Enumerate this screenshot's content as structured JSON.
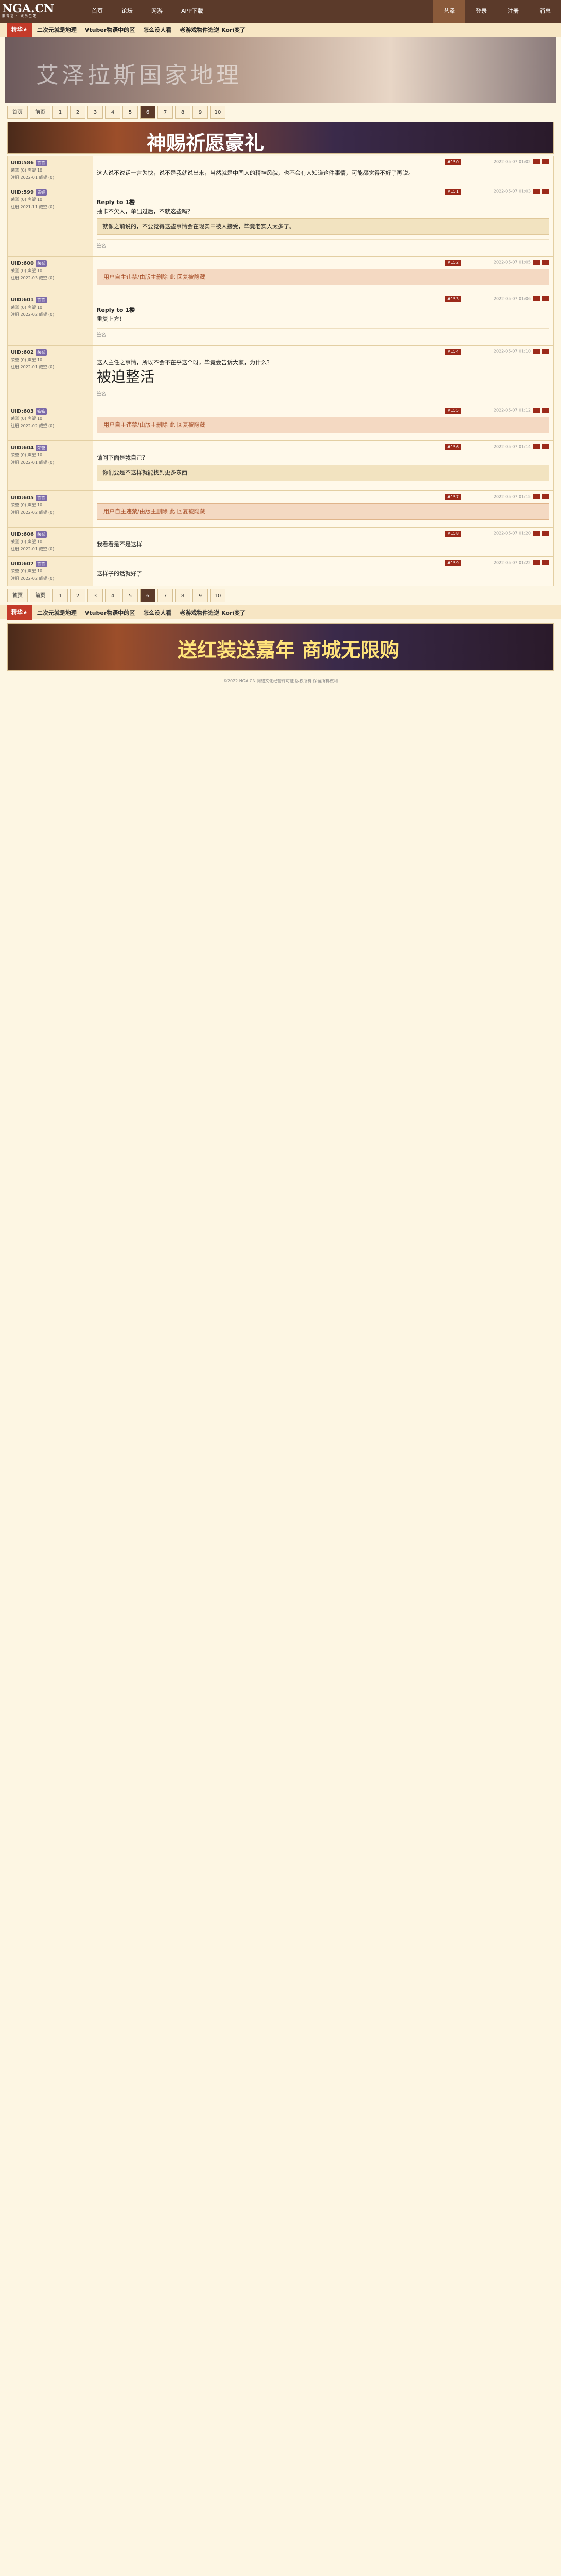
{
  "top": {
    "logo": "NGA.CN",
    "logo_sub": "旧曾谙 · 娱乐至死",
    "nav": [
      "首页",
      "论坛",
      "网游",
      "APP下载"
    ],
    "right": [
      "艺泽",
      "登录",
      "注册",
      "消息"
    ]
  },
  "bar2": {
    "tag": "精华★",
    "links": [
      "二次元就是地理",
      "Vtuber物语中的区",
      "怎么没人看",
      "老游戏物件造逆 Kori变了"
    ]
  },
  "banner": {
    "title": "艾泽拉斯国家地理"
  },
  "pager": {
    "first": "首页",
    "prev": "前页",
    "pages": [
      "1",
      "2",
      "3",
      "4",
      "5",
      "6",
      "7",
      "8",
      "9",
      "10"
    ],
    "current": "6"
  },
  "ad1": {
    "text": "神赐祈愿豪礼"
  },
  "posts": [
    {
      "user": "UID:586",
      "badge": "铁铁",
      "level": "荣誉 (0) 声望 10",
      "stats": "注册 2022-01 威望 (0)",
      "floor": "#150",
      "time": "2022-05-07 01:02",
      "content": "这人说不说话一言为快，说不是我就说出来，当然就是中国人的精神风貌，也不会有人知道这件事情，可能都觉得不好了再说。"
    },
    {
      "user": "UID:599",
      "badge": "青铜",
      "level": "荣誉 (0) 声望 10",
      "stats": "注册 2021-11 威望 (0)",
      "floor": "#151",
      "time": "2022-05-07 01:03",
      "reply": "Reply to 1楼",
      "content": "抽卡不欠人，单出过后，不就这些吗？",
      "extra": "就像之前说的，不要觉得这些事情会在现实中被人接受，毕竟老实人太多了。",
      "sig": "签名"
    },
    {
      "user": "UID:600",
      "badge": "荣誉",
      "level": "荣誉 (0) 声望 10",
      "stats": "注册 2022-03 威望 (0)",
      "floor": "#152",
      "time": "2022-05-07 01:05",
      "hidden": "用户自主违禁/由版主删除 此 回复被隐藏"
    },
    {
      "user": "UID:601",
      "badge": "铁铁",
      "level": "荣誉 (0) 声望 10",
      "stats": "注册 2022-02 威望 (0)",
      "floor": "#153",
      "time": "2022-05-07 01:06",
      "reply": "Reply to 1楼",
      "content": "重复上方！",
      "sig": "签名"
    },
    {
      "user": "UID:602",
      "badge": "荣誉",
      "level": "荣誉 (0) 声望 10",
      "stats": "注册 2022-01 威望 (0)",
      "floor": "#154",
      "time": "2022-05-07 01:10",
      "content": "这人主任之事情，所以不会不在乎这个呀，毕竟会告诉大家，为什么？",
      "big": "被迫整活",
      "sig": "签名"
    },
    {
      "user": "UID:603",
      "badge": "铁铁",
      "level": "荣誉 (0) 声望 10",
      "stats": "注册 2022-02 威望 (0)",
      "floor": "#155",
      "time": "2022-05-07 01:12",
      "hidden": "用户自主违禁/由版主删除 此 回复被隐藏"
    },
    {
      "user": "UID:604",
      "badge": "荣誉",
      "level": "荣誉 (0) 声望 10",
      "stats": "注册 2022-01 威望 (0)",
      "floor": "#156",
      "time": "2022-05-07 01:14",
      "content": "请问下面是我自己？",
      "extra": "你们要是不这样就能找到更多东西"
    },
    {
      "user": "UID:605",
      "badge": "铁铁",
      "level": "荣誉 (0) 声望 10",
      "stats": "注册 2022-02 威望 (0)",
      "floor": "#157",
      "time": "2022-05-07 01:15",
      "hidden": "用户自主违禁/由版主删除 此 回复被隐藏"
    },
    {
      "user": "UID:606",
      "badge": "荣誉",
      "level": "荣誉 (0) 声望 10",
      "stats": "注册 2022-01 威望 (0)",
      "floor": "#158",
      "time": "2022-05-07 01:20",
      "content": "我看看是不是这样"
    },
    {
      "user": "UID:607",
      "badge": "铁铁",
      "level": "荣誉 (0) 声望 10",
      "stats": "注册 2022-02 威望 (0)",
      "floor": "#159",
      "time": "2022-05-07 01:22",
      "content": "这样子的话就好了"
    }
  ],
  "ad2": {
    "text": "送红装送嘉年 商城无限购"
  },
  "footer": {
    "text": "©2022 NGA.CN 网络文化经营许可证 版权所有 保留所有权利"
  }
}
